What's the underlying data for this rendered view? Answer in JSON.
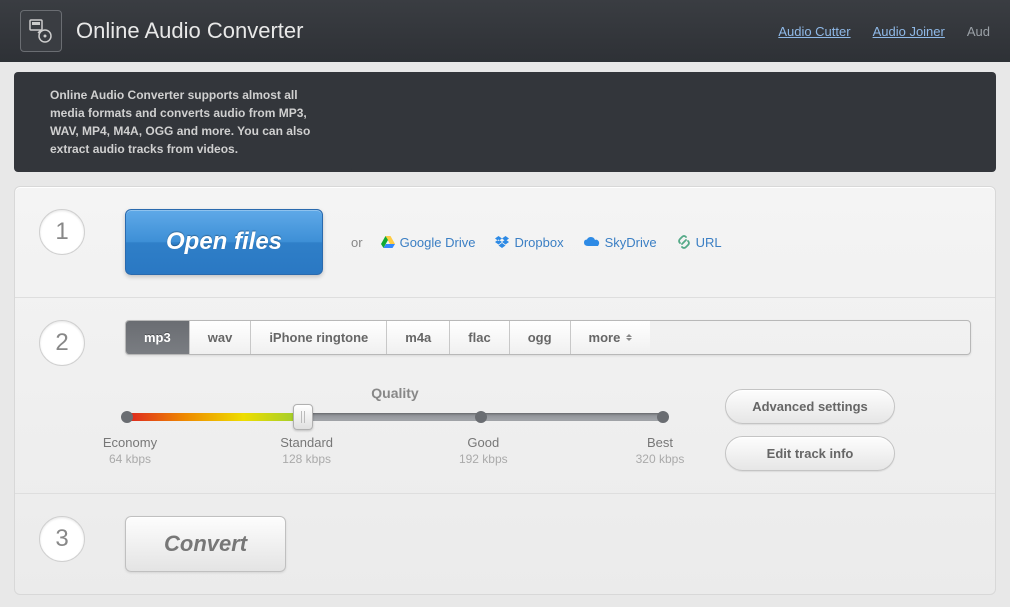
{
  "header": {
    "title": "Online Audio Converter",
    "links": [
      "Audio Cutter",
      "Audio Joiner"
    ],
    "partial_link": "Aud"
  },
  "description": "Online Audio Converter supports almost all media formats and converts audio from MP3, WAV, MP4, M4A, OGG and more. You can also extract audio tracks from videos.",
  "step1": {
    "number": "1",
    "open_label": "Open files",
    "or": "or",
    "sources": [
      {
        "label": "Google Drive",
        "icon": "gdrive"
      },
      {
        "label": "Dropbox",
        "icon": "dropbox"
      },
      {
        "label": "SkyDrive",
        "icon": "skydrive"
      },
      {
        "label": "URL",
        "icon": "link"
      }
    ]
  },
  "step2": {
    "number": "2",
    "formats": [
      "mp3",
      "wav",
      "iPhone ringtone",
      "m4a",
      "flac",
      "ogg",
      "more"
    ],
    "active_format": "mp3",
    "quality_label": "Quality",
    "stops": [
      {
        "name": "Economy",
        "rate": "64 kbps"
      },
      {
        "name": "Standard",
        "rate": "128 kbps"
      },
      {
        "name": "Good",
        "rate": "192 kbps"
      },
      {
        "name": "Best",
        "rate": "320 kbps"
      }
    ],
    "selected_stop_index": 1,
    "advanced_label": "Advanced settings",
    "edit_label": "Edit track info"
  },
  "step3": {
    "number": "3",
    "convert_label": "Convert"
  }
}
